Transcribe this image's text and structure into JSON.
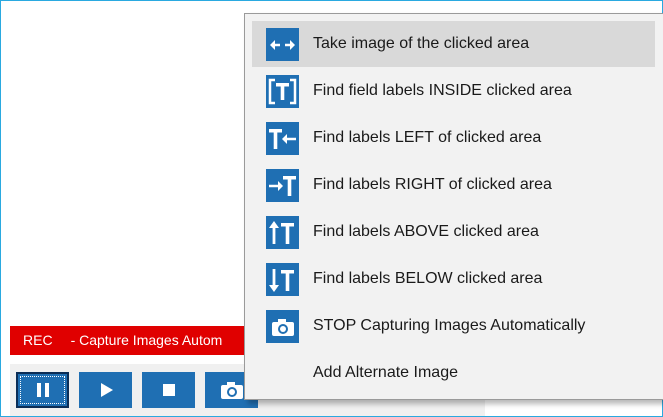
{
  "rec_bar": {
    "rec_label": "REC",
    "title": "- Capture Images Autom"
  },
  "toolbar": {
    "buttons": [
      {
        "icon": "pause-icon"
      },
      {
        "icon": "play-icon"
      },
      {
        "icon": "stop-icon"
      },
      {
        "icon": "camera-icon"
      }
    ]
  },
  "menu": {
    "items": [
      {
        "label": "Take image of the clicked area",
        "icon": "horizontal-arrows-icon"
      },
      {
        "label": "Find field labels INSIDE clicked area",
        "icon": "text-inside-icon"
      },
      {
        "label": "Find labels LEFT of clicked area",
        "icon": "label-left-icon"
      },
      {
        "label": "Find labels RIGHT of clicked area",
        "icon": "label-right-icon"
      },
      {
        "label": "Find labels ABOVE clicked area",
        "icon": "label-above-icon"
      },
      {
        "label": "Find labels BELOW clicked area",
        "icon": "label-below-icon"
      },
      {
        "label": "STOP Capturing Images Automatically",
        "icon": "camera-icon"
      },
      {
        "label": "Add Alternate Image",
        "icon": ""
      }
    ]
  },
  "colors": {
    "accent_blue": "#1f6fb3",
    "rec_red": "#e00000",
    "window_border": "#2aa9e0",
    "menu_bg": "#f2f2f2",
    "highlight": "#d9d9d9"
  }
}
